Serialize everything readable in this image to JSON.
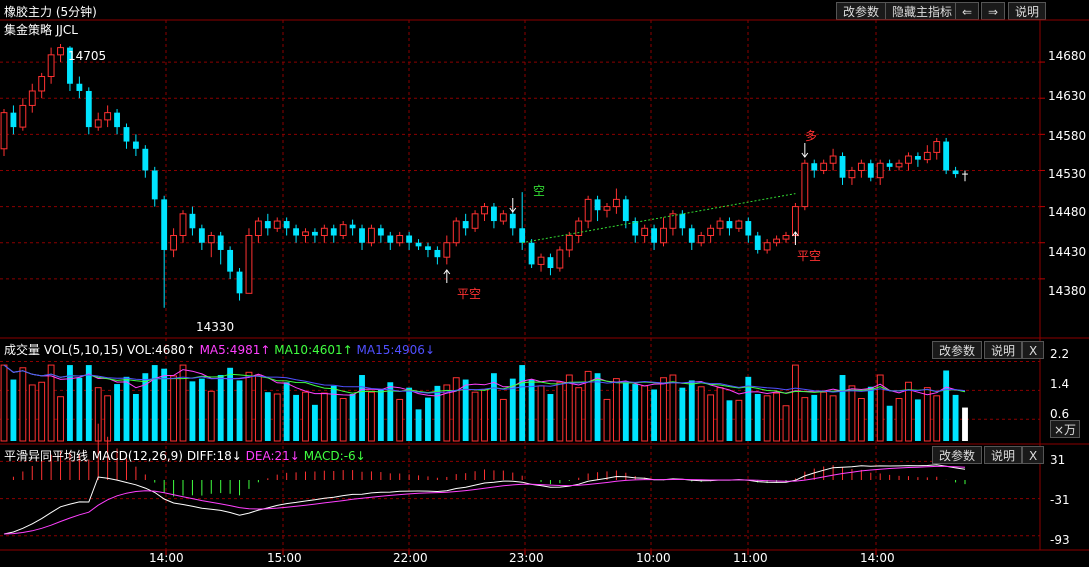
{
  "header": {
    "title": "橡胶主力 (5分钟)",
    "strategy": "集金策略 JJCL",
    "buttons": {
      "params": "改参数",
      "hide": "隐藏主指标",
      "left": "⇐",
      "right": "⇒",
      "help": "说明"
    }
  },
  "price_panel": {
    "y_ticks": [
      "14680",
      "14630",
      "14580",
      "14530",
      "14480",
      "14430",
      "14380"
    ],
    "high_label": "14705",
    "low_label": "14330",
    "signals": {
      "short": "空",
      "cover_short_1": "平空",
      "long": "多",
      "cover_short_2": "平空"
    }
  },
  "volume_panel": {
    "name": "成交量",
    "params": "VOL(5,10,15)",
    "vol": "VOL:4680↑",
    "ma5": "MA5:4981↑",
    "ma10": "MA10:4601↑",
    "ma15": "MA15:4906↓",
    "y_ticks": [
      "2.2",
      "1.4",
      "0.6"
    ],
    "unit": "×万",
    "buttons": {
      "params": "改参数",
      "help": "说明",
      "close": "X"
    }
  },
  "macd_panel": {
    "name": "平滑异同平均线",
    "params": "MACD(12,26,9)",
    "diff": "DIFF:18↓",
    "dea": "DEA:21↓",
    "macd": "MACD:-6↓",
    "y_ticks": [
      "31",
      "-31",
      "-93"
    ],
    "buttons": {
      "params": "改参数",
      "help": "说明",
      "close": "X"
    }
  },
  "x_axis": {
    "labels": [
      "14:00",
      "15:00",
      "22:00",
      "23:00",
      "10:00",
      "11:00",
      "14:00"
    ]
  },
  "colors": {
    "up": "#ff3232",
    "down": "#00e4ff",
    "ma5": "#ff40ff",
    "ma10": "#40ff40",
    "ma15": "#5050ff",
    "diff": "#ffffff",
    "dea": "#ff40ff",
    "grid": "#8b0000",
    "signal_green": "#33dd33",
    "signal_red": "#ff3232"
  },
  "chart_data": {
    "type": "candlestick",
    "title": "橡胶主力 (5分钟)",
    "y_range": [
      14330,
      14705
    ],
    "y_ticks": [
      14680,
      14630,
      14580,
      14530,
      14480,
      14430,
      14380
    ],
    "x_labels": [
      "14:00",
      "15:00",
      "22:00",
      "23:00",
      "10:00",
      "11:00",
      "14:00"
    ],
    "candles": [
      [
        14560,
        14610,
        14550,
        14615
      ],
      [
        14610,
        14590,
        14580,
        14620
      ],
      [
        14590,
        14620,
        14585,
        14630
      ],
      [
        14620,
        14640,
        14610,
        14650
      ],
      [
        14640,
        14660,
        14630,
        14665
      ],
      [
        14660,
        14690,
        14650,
        14700
      ],
      [
        14690,
        14700,
        14680,
        14705
      ],
      [
        14700,
        14650,
        14640,
        14702
      ],
      [
        14650,
        14640,
        14630,
        14660
      ],
      [
        14640,
        14590,
        14580,
        14645
      ],
      [
        14590,
        14600,
        14585,
        14610
      ],
      [
        14600,
        14610,
        14590,
        14620
      ],
      [
        14610,
        14590,
        14580,
        14615
      ],
      [
        14590,
        14570,
        14560,
        14595
      ],
      [
        14570,
        14560,
        14550,
        14580
      ],
      [
        14560,
        14530,
        14520,
        14565
      ],
      [
        14530,
        14490,
        14480,
        14535
      ],
      [
        14490,
        14420,
        14340,
        14495
      ],
      [
        14420,
        14440,
        14410,
        14450
      ],
      [
        14440,
        14470,
        14430,
        14475
      ],
      [
        14470,
        14450,
        14440,
        14480
      ],
      [
        14450,
        14430,
        14420,
        14455
      ],
      [
        14430,
        14440,
        14410,
        14445
      ],
      [
        14440,
        14420,
        14400,
        14445
      ],
      [
        14420,
        14390,
        14380,
        14425
      ],
      [
        14390,
        14360,
        14350,
        14395
      ],
      [
        14360,
        14440,
        14360,
        14450
      ],
      [
        14440,
        14460,
        14430,
        14465
      ],
      [
        14460,
        14450,
        14440,
        14470
      ],
      [
        14450,
        14460,
        14445,
        14465
      ],
      [
        14460,
        14450,
        14440,
        14465
      ],
      [
        14450,
        14440,
        14430,
        14455
      ],
      [
        14440,
        14445,
        14430,
        14450
      ],
      [
        14445,
        14440,
        14430,
        14450
      ],
      [
        14440,
        14450,
        14430,
        14455
      ],
      [
        14450,
        14440,
        14430,
        14455
      ],
      [
        14440,
        14455,
        14435,
        14460
      ],
      [
        14455,
        14450,
        14440,
        14462
      ],
      [
        14450,
        14430,
        14420,
        14455
      ],
      [
        14430,
        14450,
        14425,
        14455
      ],
      [
        14450,
        14440,
        14430,
        14455
      ],
      [
        14440,
        14430,
        14420,
        14445
      ],
      [
        14430,
        14440,
        14425,
        14445
      ],
      [
        14440,
        14430,
        14420,
        14445
      ],
      [
        14430,
        14425,
        14420,
        14435
      ],
      [
        14425,
        14420,
        14410,
        14430
      ],
      [
        14420,
        14410,
        14400,
        14425
      ],
      [
        14410,
        14430,
        14400,
        14440
      ],
      [
        14430,
        14460,
        14425,
        14465
      ],
      [
        14460,
        14450,
        14440,
        14470
      ],
      [
        14450,
        14470,
        14445,
        14475
      ],
      [
        14470,
        14480,
        14460,
        14485
      ],
      [
        14480,
        14460,
        14450,
        14485
      ],
      [
        14460,
        14470,
        14455,
        14475
      ],
      [
        14470,
        14450,
        14440,
        14475
      ],
      [
        14450,
        14430,
        14420,
        14500
      ],
      [
        14430,
        14400,
        14395,
        14435
      ],
      [
        14400,
        14410,
        14390,
        14415
      ],
      [
        14410,
        14395,
        14385,
        14415
      ],
      [
        14395,
        14420,
        14390,
        14425
      ],
      [
        14420,
        14440,
        14410,
        14445
      ],
      [
        14440,
        14460,
        14430,
        14465
      ],
      [
        14460,
        14490,
        14450,
        14495
      ],
      [
        14490,
        14475,
        14460,
        14495
      ],
      [
        14475,
        14480,
        14465,
        14485
      ],
      [
        14480,
        14490,
        14470,
        14505
      ],
      [
        14490,
        14460,
        14450,
        14495
      ],
      [
        14460,
        14440,
        14430,
        14465
      ],
      [
        14440,
        14450,
        14430,
        14455
      ],
      [
        14450,
        14430,
        14420,
        14455
      ],
      [
        14430,
        14450,
        14425,
        14465
      ],
      [
        14450,
        14470,
        14440,
        14475
      ],
      [
        14470,
        14450,
        14440,
        14475
      ],
      [
        14450,
        14430,
        14420,
        14455
      ],
      [
        14430,
        14440,
        14425,
        14445
      ],
      [
        14440,
        14450,
        14430,
        14455
      ],
      [
        14450,
        14460,
        14440,
        14465
      ],
      [
        14460,
        14450,
        14440,
        14465
      ],
      [
        14450,
        14460,
        14445,
        14462
      ],
      [
        14460,
        14440,
        14430,
        14465
      ],
      [
        14440,
        14420,
        14415,
        14445
      ],
      [
        14420,
        14430,
        14415,
        14435
      ],
      [
        14430,
        14435,
        14425,
        14440
      ],
      [
        14435,
        14440,
        14430,
        14445
      ],
      [
        14440,
        14480,
        14430,
        14485
      ],
      [
        14480,
        14540,
        14475,
        14545
      ],
      [
        14540,
        14530,
        14520,
        14545
      ],
      [
        14530,
        14540,
        14525,
        14545
      ],
      [
        14540,
        14550,
        14530,
        14560
      ],
      [
        14550,
        14520,
        14510,
        14555
      ],
      [
        14520,
        14530,
        14510,
        14535
      ],
      [
        14530,
        14540,
        14520,
        14545
      ],
      [
        14540,
        14520,
        14515,
        14545
      ],
      [
        14520,
        14540,
        14510,
        14545
      ],
      [
        14540,
        14535,
        14530,
        14545
      ],
      [
        14535,
        14540,
        14530,
        14545
      ],
      [
        14540,
        14550,
        14530,
        14555
      ],
      [
        14550,
        14545,
        14535,
        14555
      ],
      [
        14545,
        14555,
        14540,
        14565
      ],
      [
        14555,
        14570,
        14545,
        14575
      ],
      [
        14570,
        14530,
        14525,
        14575
      ],
      [
        14530,
        14525,
        14520,
        14535
      ],
      [
        14525,
        14525,
        14515,
        14530
      ]
    ],
    "signals": [
      {
        "label": "空",
        "index": 54,
        "price": 14500,
        "color": "green"
      },
      {
        "label": "平空",
        "index": 47,
        "price": 14420,
        "color": "red"
      },
      {
        "label": "多",
        "index": 85,
        "price": 14560,
        "color": "red"
      },
      {
        "label": "平空",
        "index": 84,
        "price": 14430,
        "color": "red"
      }
    ],
    "volume_ticks": [
      2.2,
      1.4,
      0.6
    ],
    "volume_unit": "×万",
    "macd_ticks": [
      31,
      -31,
      -93
    ]
  }
}
